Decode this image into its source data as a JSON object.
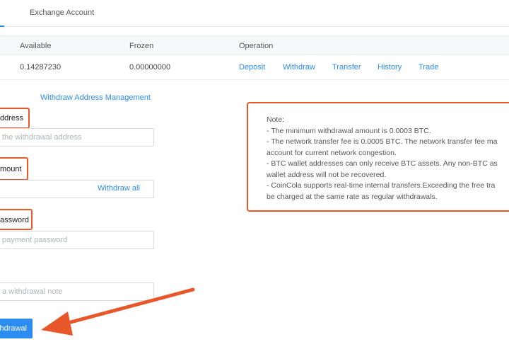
{
  "tabs": {
    "active_stub": "",
    "exchange_account": "Exchange Account"
  },
  "table": {
    "headers": {
      "available": "Available",
      "frozen": "Frozen",
      "operation": "Operation"
    },
    "row": {
      "available": "0.14287230",
      "frozen": "0.00000000"
    },
    "operations": [
      "Deposit",
      "Withdraw",
      "Transfer",
      "History",
      "Trade"
    ]
  },
  "form": {
    "address_management": "Withdraw Address Management",
    "address_label": "ddress",
    "address_placeholder": "the withdrawal address",
    "amount_label": "mount",
    "withdraw_all": "Withdraw all",
    "password_label": "assword",
    "password_placeholder": "payment password",
    "note_placeholder": "a withdrawal note",
    "submit": "hdrawal"
  },
  "note": {
    "lines": [
      "Note:",
      "- The minimum withdrawal amount is 0.0003 BTC.",
      "- The network transfer fee is 0.0005 BTC. The network transfer fee ma",
      "account for current network congestion.",
      "- BTC wallet addresses can only receive BTC assets. Any non-BTC as",
      "wallet address will not be recovered.",
      "- CoinCola supports real-time internal transfers.Exceeding the free tra",
      "be charged at the same rate as regular withdrawals."
    ]
  },
  "colors": {
    "accent": "#2d8cf0",
    "highlight": "#e8572a"
  }
}
